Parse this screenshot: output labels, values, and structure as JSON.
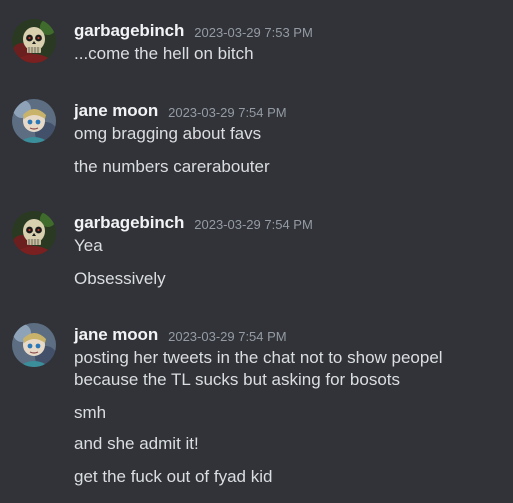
{
  "channel": {
    "messages": [
      {
        "author": "garbagebinch",
        "timestamp": "2023-03-29 7:53 PM",
        "avatar_icon": "skull-avatar-icon",
        "lines": [
          "...come the hell on bitch"
        ]
      },
      {
        "author": "jane moon",
        "timestamp": "2023-03-29 7:54 PM",
        "avatar_icon": "moon-character-avatar-icon",
        "lines": [
          "omg bragging about favs",
          "the numbers carerabouter"
        ]
      },
      {
        "author": "garbagebinch",
        "timestamp": "2023-03-29 7:54 PM",
        "avatar_icon": "skull-avatar-icon",
        "lines": [
          "Yea",
          "Obsessively"
        ]
      },
      {
        "author": "jane moon",
        "timestamp": "2023-03-29 7:54 PM",
        "avatar_icon": "moon-character-avatar-icon",
        "lines": [
          "posting her tweets in the chat not to show peopel because the TL sucks but asking for bosots",
          "smh",
          "and she admit it!",
          "get the fuck out of fyad kid"
        ]
      }
    ]
  },
  "theme": {
    "background": "#313338",
    "username_color": "#f2f3f5",
    "text_color": "#dbdee1",
    "timestamp_color": "#949ba4"
  }
}
